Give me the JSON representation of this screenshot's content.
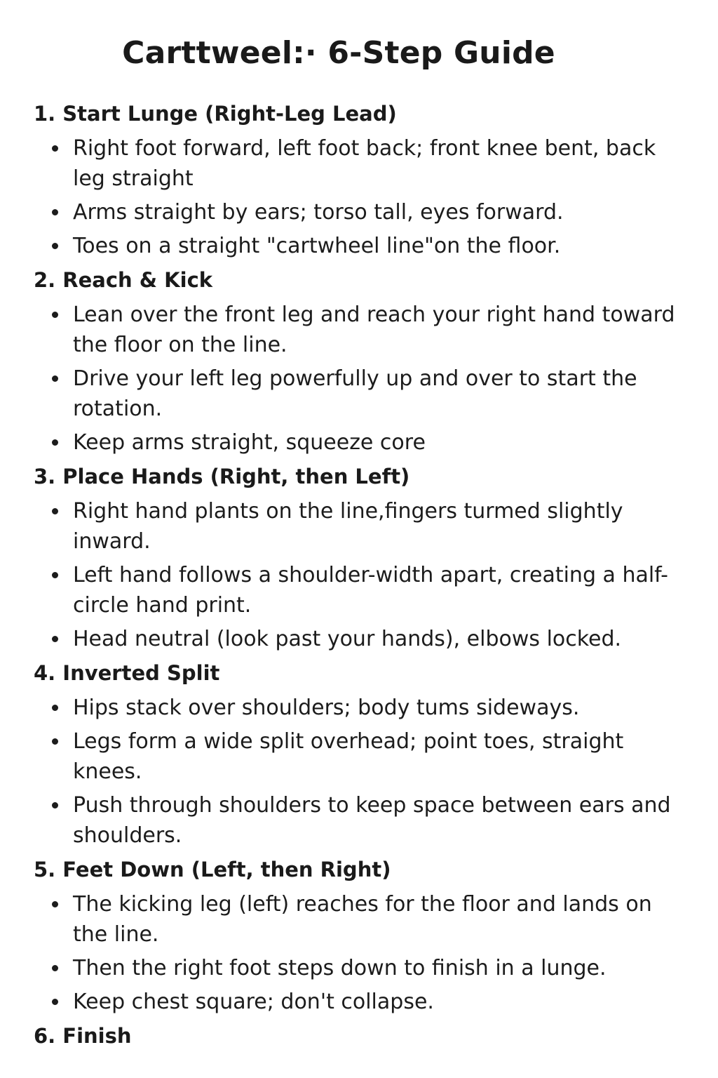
{
  "title": "Carttweel:· 6-Step Guide",
  "steps": [
    {
      "heading": "1. Start Lunge (Right-Leg Lead)",
      "bullets": [
        "Right foot forward, left foot back;  front knee bent, back leg straight",
        "Arms straight by ears; torso tall, eyes forward.",
        "Toes on a straight \"cartwheel line\"on the floor."
      ]
    },
    {
      "heading": "2. Reach & Kick",
      "bullets": [
        "Lean over the front leg and reach your right hand toward the floor on the line.",
        "Drive your left leg powerfully up and over to start the rotation.",
        "Keep arms straight, squeeze core"
      ]
    },
    {
      "heading": "3. Place Hands (Right, then Left)",
      "bullets": [
        "Right hand plants on the line,fingers turmed slightly inward.",
        "Left hand follows a shoulder-width apart, creating a half-circle hand print.",
        "Head neutral (look past your hands), elbows locked."
      ]
    },
    {
      "heading": "4. Inverted Split",
      "bullets": [
        "Hips stack over shoulders; body tums sideways.",
        "Legs form a wide split overhead; point toes, straight knees.",
        "Push through shoulders to keep space between ears and shoulders."
      ]
    },
    {
      "heading": "5. Feet Down (Left, then Right)",
      "bullets": [
        "The kicking leg (left) reaches  for the floor and lands on the line.",
        "Then the right foot steps down to finish in a lunge.",
        "Keep chest square; don't collapse."
      ]
    },
    {
      "heading": "6. Finish",
      "bullets": []
    }
  ]
}
